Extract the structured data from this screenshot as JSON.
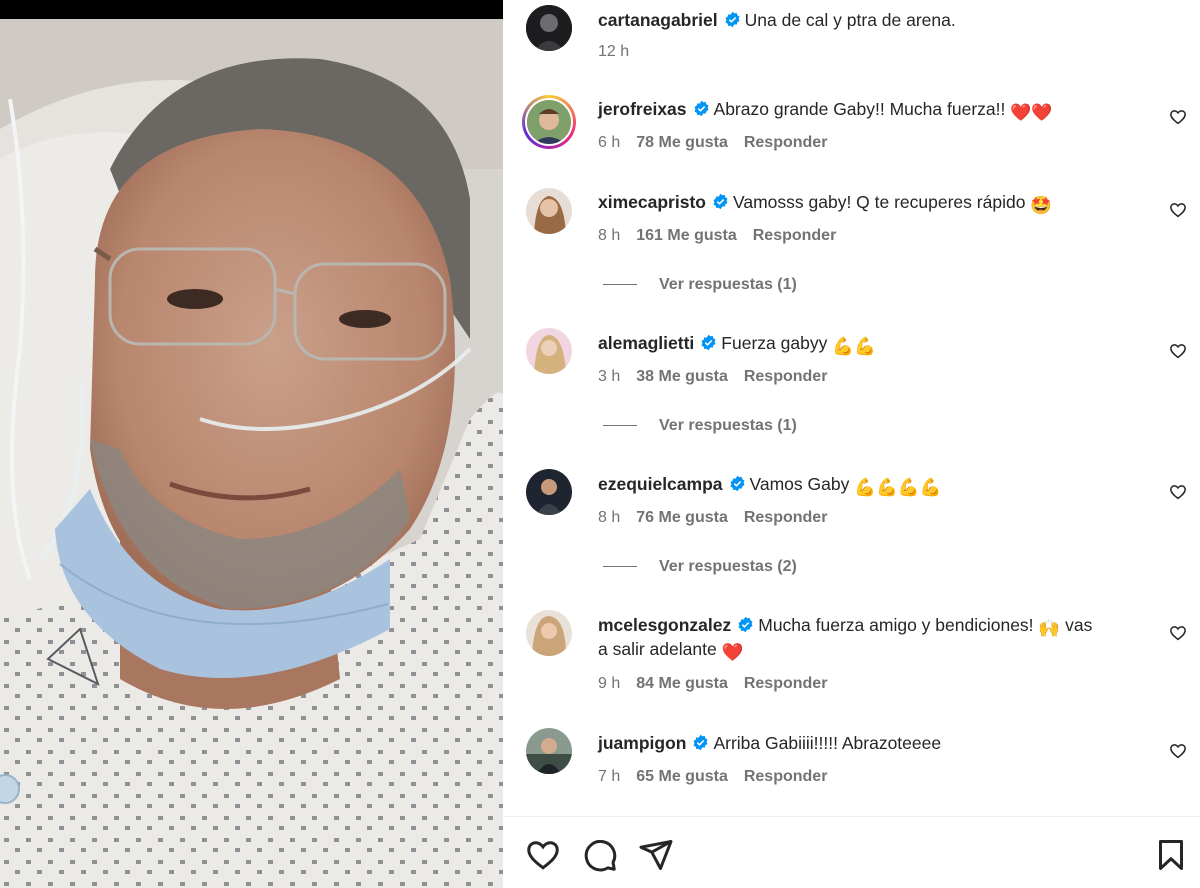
{
  "post": {
    "author": "cartanagabriel",
    "caption": "Una de cal y ptra de arena.",
    "time": "12 h"
  },
  "comments": [
    {
      "username": "jerofreixas",
      "text": "Abrazo grande Gaby!! Mucha fuerza!!",
      "emoji": "❤️❤️",
      "time": "6 h",
      "likes": "78 Me gusta",
      "reply": "Responder"
    },
    {
      "username": "ximecapristo",
      "text": "Vamosss gaby! Q te recuperes rápido",
      "emoji": "🤩",
      "time": "8 h",
      "likes": "161 Me gusta",
      "reply": "Responder",
      "view_replies": "Ver respuestas (1)"
    },
    {
      "username": "alemaglietti",
      "text": "Fuerza gabyy",
      "emoji": "💪💪",
      "time": "3 h",
      "likes": "38 Me gusta",
      "reply": "Responder",
      "view_replies": "Ver respuestas (1)"
    },
    {
      "username": "ezequielcampa",
      "text": "Vamos Gaby",
      "emoji": "💪💪💪💪",
      "time": "8 h",
      "likes": "76 Me gusta",
      "reply": "Responder",
      "view_replies": "Ver respuestas (2)"
    },
    {
      "username": "mcelesgonzalez",
      "text": "Mucha fuerza amigo y bendiciones!",
      "emoji": "🙌",
      "text_line2": "vas",
      "text_line3": "a salir adelante",
      "emoji2": "❤️",
      "time": "9 h",
      "likes": "84 Me gusta",
      "reply": "Responder"
    },
    {
      "username": "juampigon",
      "text": "Arriba Gabiiii!!!!! Abrazoteeee",
      "emoji": "",
      "time": "7 h",
      "likes": "65 Me gusta",
      "reply": "Responder"
    }
  ],
  "icons": {
    "verified": "verified-badge-icon",
    "like": "heart-outline-icon",
    "comment": "comment-bubble-icon",
    "share": "paper-plane-icon",
    "save": "bookmark-icon"
  },
  "colors": {
    "verified_blue": "#0095f6",
    "heart_red": "#ff3040",
    "meta_gray": "#737373",
    "text": "#262626"
  }
}
